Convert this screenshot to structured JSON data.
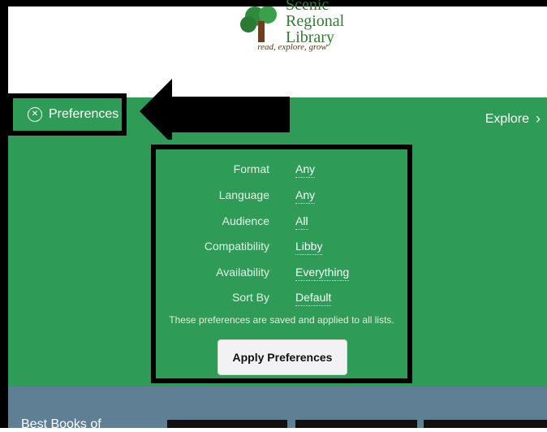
{
  "library": {
    "name_line1": "Scenic",
    "name_line2": "Regional",
    "name_line3": "Library",
    "tagline": "read, explore, grow"
  },
  "nav": {
    "preferences_label": "Preferences",
    "explore_label": "Explore"
  },
  "preferences": {
    "rows": [
      {
        "label": "Format",
        "value": "Any"
      },
      {
        "label": "Language",
        "value": "Any"
      },
      {
        "label": "Audience",
        "value": "All"
      },
      {
        "label": "Compatibility",
        "value": "Libby"
      },
      {
        "label": "Availability",
        "value": "Everything"
      },
      {
        "label": "Sort By",
        "value": "Default"
      }
    ],
    "note": "These preferences are saved and applied to all lists.",
    "apply_label": "Apply Preferences"
  },
  "bottom": {
    "section_title": "Best Books of"
  },
  "colors": {
    "green": "#2e9b56",
    "slate": "#5f7f95"
  }
}
